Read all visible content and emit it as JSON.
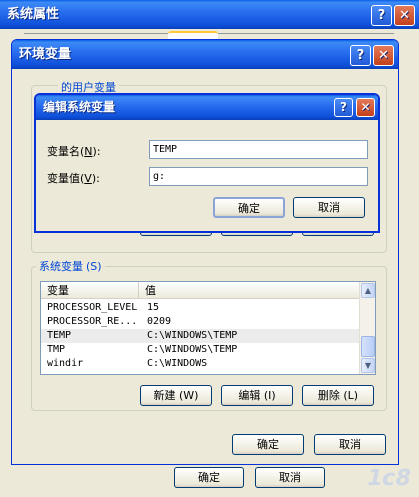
{
  "system_properties": {
    "title": "系统属性",
    "help": "?",
    "close": "✕",
    "ok": "确定",
    "cancel": "取消"
  },
  "env_vars": {
    "title": "环境变量",
    "help": "?",
    "close": "✕",
    "user_group_label": "的用户变量",
    "system_group_label": "系统变量",
    "system_group_key": "(S)",
    "columns": [
      "变量",
      "值"
    ],
    "rows": [
      {
        "name": "PROCESSOR_LEVEL",
        "value": "15"
      },
      {
        "name": "PROCESSOR_RE...",
        "value": "0209"
      },
      {
        "name": "TEMP",
        "value": "C:\\WINDOWS\\TEMP"
      },
      {
        "name": "TMP",
        "value": "C:\\WINDOWS\\TEMP"
      },
      {
        "name": "windir",
        "value": "C:\\WINDOWS"
      }
    ],
    "new_btn": "新建",
    "new_key": "(W)",
    "edit_btn": "编辑",
    "edit_key": "(I)",
    "delete_btn": "删除",
    "delete_key": "(L)",
    "ok": "确定",
    "cancel": "取消"
  },
  "edit_dialog": {
    "title": "编辑系统变量",
    "help": "?",
    "close": "✕",
    "name_label": "变量名",
    "name_key": "N",
    "value_label": "变量值",
    "value_key": "V",
    "name_value": "TEMP",
    "value_value": "g:",
    "ok": "确定",
    "cancel": "取消"
  },
  "watermark": "1c8"
}
